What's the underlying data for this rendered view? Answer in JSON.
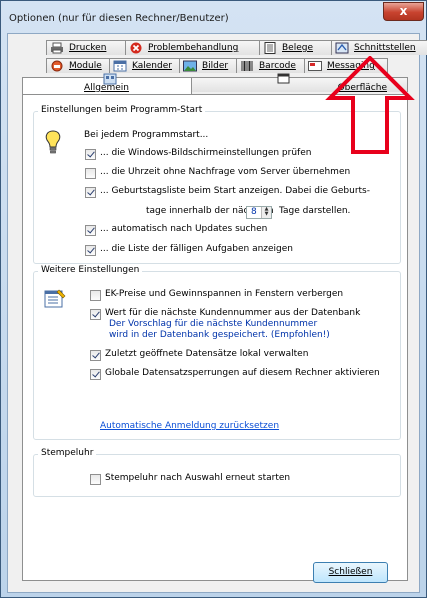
{
  "window": {
    "title": "Optionen (nur für diesen Rechner/Benutzer)",
    "close_label": "x"
  },
  "tabs_row1": [
    {
      "label": "Drucken",
      "icon": "printer-icon"
    },
    {
      "label": "Problembehandlung",
      "icon": "error-icon"
    },
    {
      "label": "Belege",
      "icon": "document-icon"
    },
    {
      "label": "Schnittstellen",
      "icon": "interface-icon"
    }
  ],
  "tabs_row2": [
    {
      "label": "Module",
      "icon": "module-icon"
    },
    {
      "label": "Kalender",
      "icon": "calendar-icon"
    },
    {
      "label": "Bilder",
      "icon": "image-icon"
    },
    {
      "label": "Barcode",
      "icon": "barcode-icon"
    },
    {
      "label": "Messaging",
      "icon": "message-icon"
    }
  ],
  "tabs_row3": [
    {
      "label": "Allgemein",
      "icon": "settings-icon",
      "active": true
    },
    {
      "label": "Oberfläche",
      "icon": "window-icon",
      "active": false
    }
  ],
  "start_group": {
    "title": "Einstellungen beim Programm-Start",
    "icon": "lightbulb-icon",
    "intro": "Bei jedem Programmstart...",
    "options": [
      {
        "label": "... die Windows-Bildschirmeinstellungen prüfen",
        "checked": true
      },
      {
        "label": "... die Uhrzeit ohne Nachfrage vom Server übernehmen",
        "checked": false
      },
      {
        "label": "... Geburtstagsliste beim Start anzeigen. Dabei die Geburts-",
        "checked": true
      },
      {
        "label": "... automatisch nach Updates suchen",
        "checked": true
      },
      {
        "label": "... die Liste der fälligen Aufgaben anzeigen",
        "checked": true
      }
    ],
    "birthday_prefix": "tage innerhalb der nächsten",
    "birthday_days": "8",
    "birthday_suffix": "Tage darstellen."
  },
  "more_group": {
    "title": "Weitere Einstellungen",
    "icon": "form-icon",
    "options": [
      {
        "label": "EK-Preise und Gewinnspannen in Fenstern verbergen",
        "checked": false
      },
      {
        "label": "Wert für die nächste Kundennummer aus der Datenbank",
        "checked": true
      },
      {
        "label": "Zuletzt geöffnete Datensätze lokal verwalten",
        "checked": true
      },
      {
        "label": "Globale Datensatzsperrungen auf diesem Rechner aktivieren",
        "checked": true
      }
    ],
    "hint_line1": "Der Vorschlag für die nächste Kundennummer",
    "hint_line2": "wird in der Datenbank gespeichert. (Empfohlen!)",
    "reset_link": "Automatische Anmeldung zurücksetzen"
  },
  "stamp_group": {
    "title": "Stempeluhr",
    "option": {
      "label": "Stempeluhr nach Auswahl erneut starten",
      "checked": false
    }
  },
  "close_button": "Schließen",
  "colors": {
    "accent_arrow": "#e8001c",
    "link": "#0b4fd6",
    "hint": "#0033aa"
  }
}
